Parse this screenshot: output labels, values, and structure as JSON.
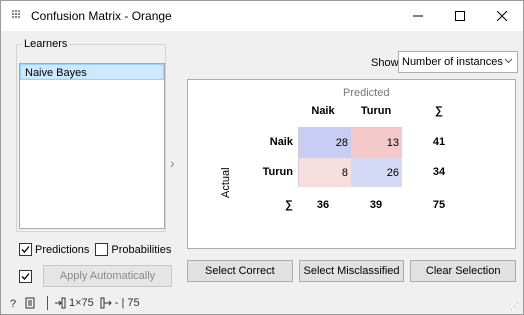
{
  "window": {
    "title": "Confusion Matrix - Orange"
  },
  "learners": {
    "legend": "Learners",
    "items": [
      {
        "label": "Naive Bayes",
        "selected": true
      }
    ]
  },
  "options": {
    "predictions": {
      "label": "Predictions",
      "checked": true
    },
    "probabilities": {
      "label": "Probabilities",
      "checked": false
    }
  },
  "apply": {
    "checked": true,
    "label": "Apply Automatically"
  },
  "status": {
    "left_count": "1×75",
    "right_count": "- | 75"
  },
  "show": {
    "label": "Show:",
    "value": "Number of instances"
  },
  "matrix": {
    "predicted_label": "Predicted",
    "actual_label": "Actual",
    "columns": [
      "Naik",
      "Turun"
    ],
    "rows": [
      "Naik",
      "Turun"
    ],
    "sum_symbol": "∑",
    "values": [
      [
        28,
        13
      ],
      [
        8,
        26
      ]
    ],
    "row_sums": [
      "41",
      "34"
    ],
    "col_sums": [
      "36",
      "39"
    ],
    "total": "75",
    "colors": {
      "diag": "#c9cdf3",
      "offdiag": "#f4c9c9",
      "offdiag_light": "#f7dede",
      "diag_alt": "#d4d9f6"
    }
  },
  "buttons": {
    "select_correct": "Select Correct",
    "select_misclassified": "Select Misclassified",
    "clear_selection": "Clear Selection"
  }
}
